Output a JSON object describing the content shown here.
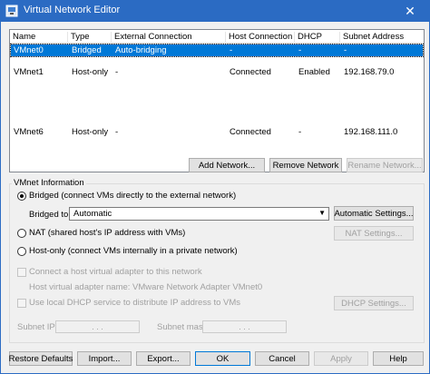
{
  "window": {
    "title": "Virtual Network Editor",
    "close_glyph": "✕"
  },
  "table": {
    "columns": [
      "Name",
      "Type",
      "External Connection",
      "Host Connection",
      "DHCP",
      "Subnet Address"
    ],
    "rows": [
      {
        "name": "VMnet0",
        "type": "Bridged",
        "external": "Auto-bridging",
        "host": "-",
        "dhcp": "-",
        "subnet": "-"
      },
      {
        "name": "VMnet1",
        "type": "Host-only",
        "external": "-",
        "host": "Connected",
        "dhcp": "Enabled",
        "subnet": "192.168.79.0"
      },
      {
        "name": "VMnet6",
        "type": "Host-only",
        "external": "-",
        "host": "Connected",
        "dhcp": "-",
        "subnet": "192.168.111.0"
      }
    ],
    "selected_row": 0
  },
  "list_buttons": {
    "add": "Add Network...",
    "remove": "Remove Network",
    "rename": "Rename Network..."
  },
  "vmnet_info": {
    "group_label": "VMnet Information",
    "bridged_label": "Bridged (connect VMs directly to the external network)",
    "bridged_to_label": "Bridged to:",
    "bridged_to_value": "Automatic",
    "automatic_settings": "Automatic Settings...",
    "nat_label": "NAT (shared host's IP address with VMs)",
    "nat_settings": "NAT Settings...",
    "hostonly_label": "Host-only (connect VMs internally in a private network)",
    "connect_adapter_label": "Connect a host virtual adapter to this network",
    "adapter_name_label": "Host virtual adapter name: VMware Network Adapter VMnet0",
    "dhcp_label": "Use local DHCP service to distribute IP address to VMs",
    "dhcp_settings": "DHCP Settings...",
    "subnet_ip_label": "Subnet IP:",
    "subnet_mask_label": "Subnet mask:",
    "ip_dots": ".      .      ."
  },
  "footer": {
    "restore": "Restore Defaults",
    "import": "Import...",
    "export": "Export...",
    "ok": "OK",
    "cancel": "Cancel",
    "apply": "Apply",
    "help": "Help"
  },
  "colors": {
    "titlebar": "#2b6bc3",
    "selection": "#0078d7"
  }
}
